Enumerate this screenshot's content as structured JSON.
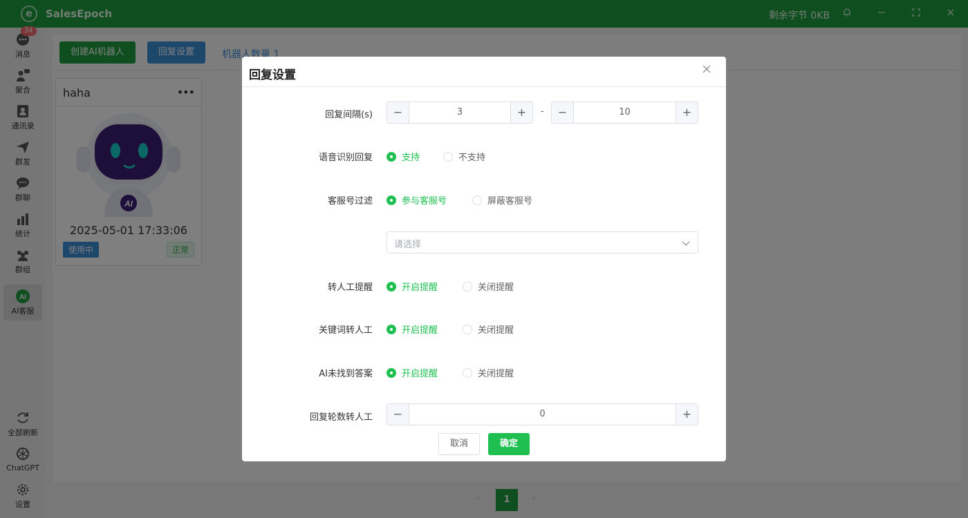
{
  "titlebar": {
    "app_name": "SalesEpoch",
    "logo_letter": "e",
    "storage": "剩余字节 0KB"
  },
  "sidebar": {
    "items": [
      {
        "label": "消息",
        "icon": "message-icon",
        "badge": "34"
      },
      {
        "label": "聚合",
        "icon": "aggregate-icon"
      },
      {
        "label": "通讯录",
        "icon": "contacts-icon"
      },
      {
        "label": "群发",
        "icon": "send-icon"
      },
      {
        "label": "群聊",
        "icon": "group-chat-icon"
      },
      {
        "label": "统计",
        "icon": "stats-icon"
      },
      {
        "label": "群组",
        "icon": "groups-icon"
      },
      {
        "label": "AI客服",
        "icon": "ai-service-icon",
        "active": true
      }
    ],
    "bottom_items": [
      {
        "label": "全部刷新",
        "icon": "refresh-icon"
      },
      {
        "label": "ChatGPT",
        "icon": "chatgpt-icon"
      },
      {
        "label": "设置",
        "icon": "settings-icon"
      }
    ]
  },
  "toolbar": {
    "create_label": "创建AI机器人",
    "reply_settings_label": "回复设置",
    "robot_count": "机器人数量 1"
  },
  "card": {
    "name": "haha",
    "more": "•••",
    "robot_badge": "AI",
    "time": "2025-05-01 17:33:06",
    "status_use": "使用中",
    "status_ok": "正常"
  },
  "pagination": {
    "prev": "‹",
    "current": "1",
    "next": "›"
  },
  "modal": {
    "title": "回复设置",
    "interval": {
      "label": "回复间隔(s)",
      "min": "3",
      "sep": "-",
      "max": "10"
    },
    "voice": {
      "label": "语音识别回复",
      "options": [
        "支持",
        "不支持"
      ],
      "selected": 0
    },
    "service_filter": {
      "label": "客服号过滤",
      "options": [
        "参与客服号",
        "屏蔽客服号"
      ],
      "selected": 0,
      "placeholder": "请选择"
    },
    "manual_reminder": {
      "label": "转人工提醒",
      "options": [
        "开启提醒",
        "关闭提醒"
      ],
      "selected": 0
    },
    "keyword_manual": {
      "label": "关键词转人工",
      "options": [
        "开启提醒",
        "关闭提醒"
      ],
      "selected": 0
    },
    "ai_no_answer": {
      "label": "AI未找到答案",
      "options": [
        "开启提醒",
        "关闭提醒"
      ],
      "selected": 0
    },
    "rounds_manual": {
      "label": "回复轮数转人工",
      "value": "0"
    },
    "cancel_label": "取消",
    "confirm_label": "确定"
  },
  "colors": {
    "brand_green": "#1f9e3e",
    "accent_blue": "#3d8fd8",
    "radio_green": "#1fbf52",
    "badge_red": "#f56c6c"
  }
}
